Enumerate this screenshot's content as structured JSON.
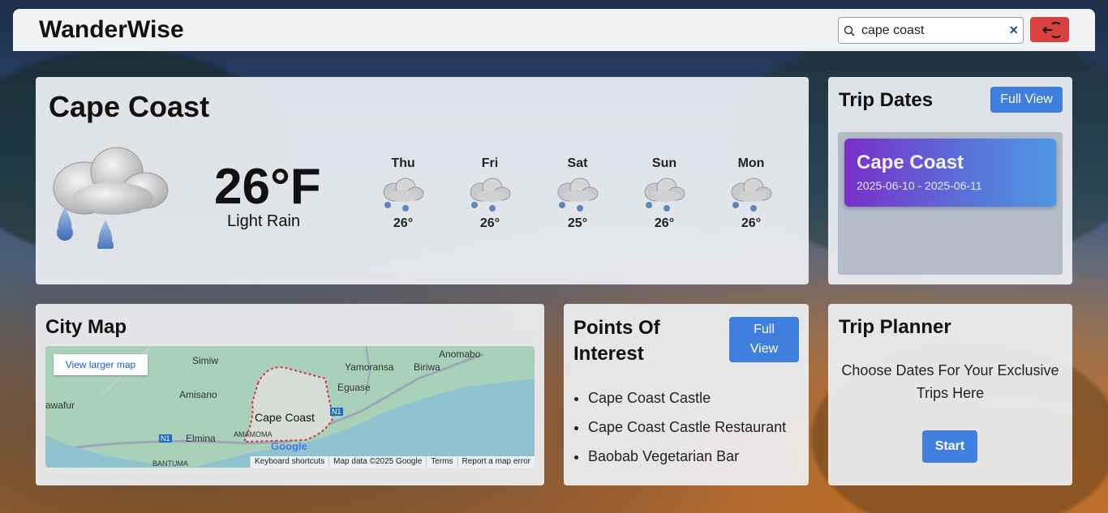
{
  "app": {
    "brand": "WanderWise"
  },
  "search": {
    "value": "cape coast",
    "clear_icon": "×"
  },
  "weather": {
    "city": "Cape Coast",
    "temp": "26°F",
    "condition": "Light Rain",
    "forecast": [
      {
        "day": "Thu",
        "temp": "26°"
      },
      {
        "day": "Fri",
        "temp": "26°"
      },
      {
        "day": "Sat",
        "temp": "25°"
      },
      {
        "day": "Sun",
        "temp": "26°"
      },
      {
        "day": "Mon",
        "temp": "26°"
      }
    ]
  },
  "trip_dates": {
    "title": "Trip Dates",
    "full_view": "Full View",
    "trip": {
      "name": "Cape Coast",
      "dates": "2025-06-10 - 2025-06-11"
    }
  },
  "city_map": {
    "title": "City Map",
    "view_larger": "View larger map",
    "labels": {
      "simiw": "Simiw",
      "yamoransa": "Yamoransa",
      "anomabo": "Anomabo",
      "biriwa": "Biriwa",
      "amisano": "Amisano",
      "eguase": "Eguase",
      "awafur": "awafur",
      "cape_coast": "Cape Coast",
      "elmina": "Elmina",
      "amamoma": "AMAMOMA",
      "bantuma": "BANTUMA",
      "n1a": "N1",
      "n1b": "N1",
      "google": "Google"
    },
    "footer": [
      "Keyboard shortcuts",
      "Map data ©2025 Google",
      "Terms",
      "Report a map error"
    ]
  },
  "poi": {
    "title_line1": "Points Of",
    "title_line2": "Interest",
    "full_view_line1": "Full",
    "full_view_line2": "View",
    "items": [
      "Cape Coast Castle",
      "Cape Coast Castle Restaurant",
      "Baobab Vegetarian Bar"
    ]
  },
  "planner": {
    "title": "Trip Planner",
    "text": "Choose Dates For Your Exclusive Trips Here",
    "start": "Start"
  }
}
